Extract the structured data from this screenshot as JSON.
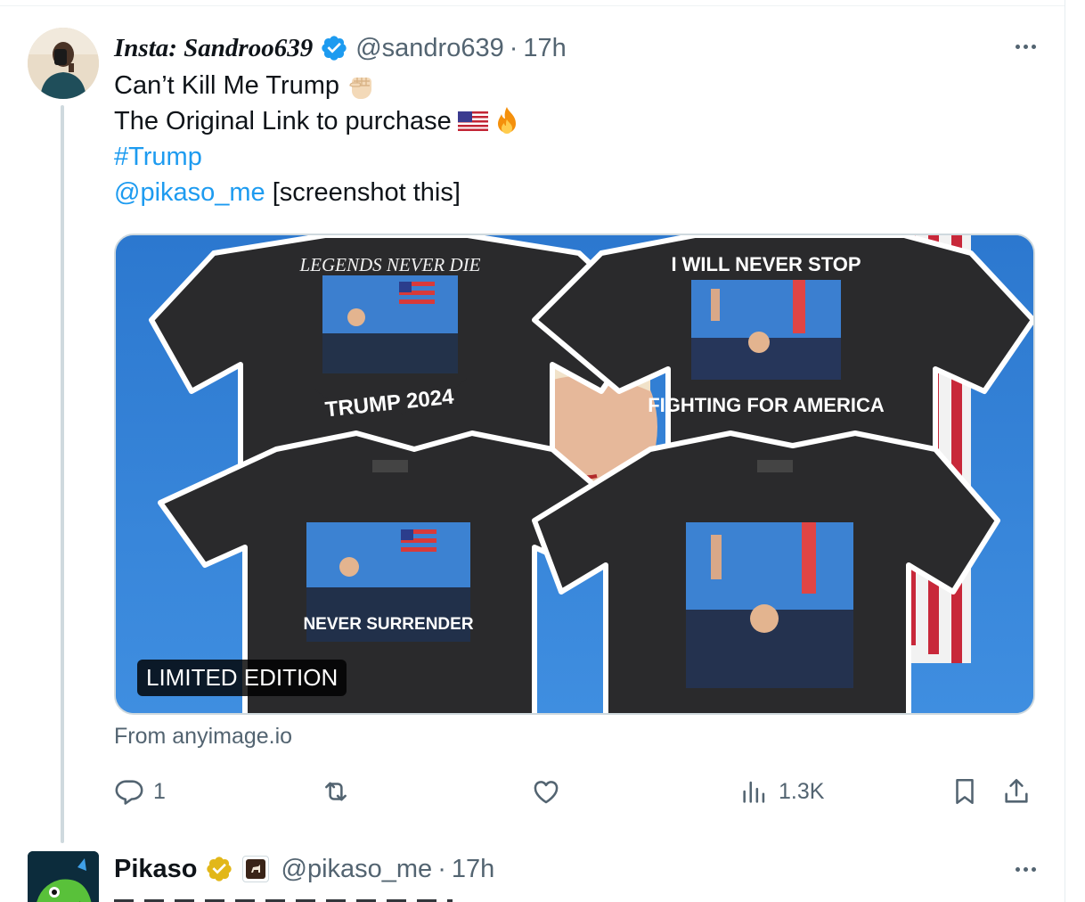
{
  "tweet": {
    "display_name": "Insta: Sandroo639",
    "handle": "@sandro639",
    "separator": "·",
    "time": "17h",
    "lines": {
      "line1": "Can’t Kill Me Trump",
      "line2": "The Original Link to purchase",
      "hashtag": "#Trump",
      "mention": "@pikaso_me",
      "mention_suffix": " [screenshot this]"
    },
    "media": {
      "badge": "LIMITED EDITION",
      "shirt1_top": "LEGENDS NEVER DIE",
      "shirt1_bottom": "TRUMP 2024",
      "shirt2_top": "I WILL NEVER STOP",
      "shirt2_bottom": "FIGHTING FOR AMERICA",
      "shirt3_bottom": "NEVER SURRENDER"
    },
    "source": "From anyimage.io",
    "actions": {
      "replies": "1",
      "views": "1.3K"
    }
  },
  "next_tweet": {
    "display_name": "Pikaso",
    "handle": "@pikaso_me",
    "separator": "·",
    "time": "17h"
  },
  "icons": [
    "verified-badge-icon",
    "raised-fist-emoji",
    "us-flag-emoji",
    "fire-emoji",
    "more-icon",
    "reply-icon",
    "retweet-icon",
    "like-icon",
    "views-icon",
    "bookmark-icon",
    "share-icon",
    "gold-verified-badge-icon",
    "affiliate-badge-icon"
  ],
  "colors": {
    "link": "#1d9bf0",
    "secondary_text": "#536471",
    "verified_blue": "#1d9bf0",
    "verified_gold": "#e2b719"
  }
}
